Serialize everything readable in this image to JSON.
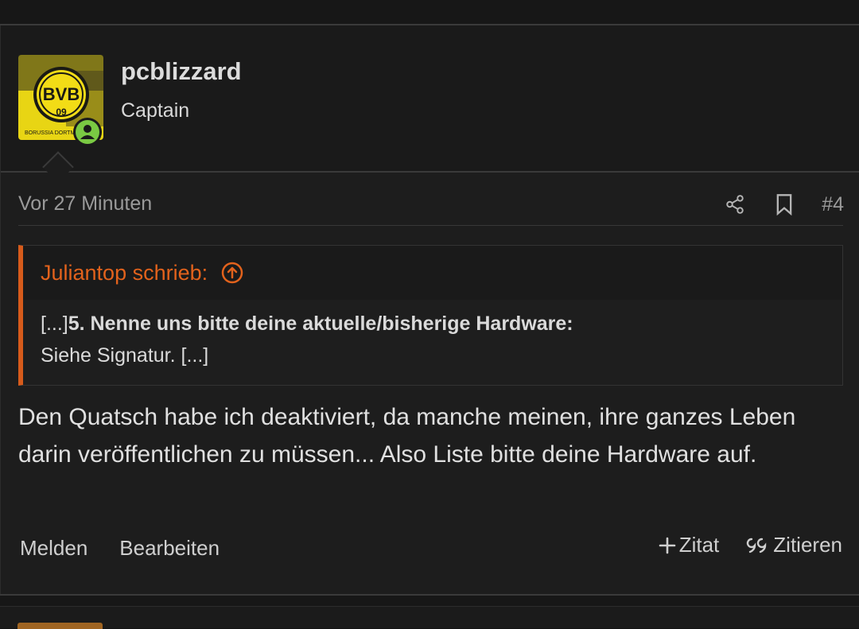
{
  "post": {
    "username": "pcblizzard",
    "rank": "Captain",
    "time": "Vor 27 Minuten",
    "number": "#4",
    "avatar_text": "BVB 09",
    "quote": {
      "title": "Juliantop schrieb:",
      "prefix": "[...]",
      "bold": "5. Nenne uns bitte deine aktuelle/bisherige Hardware:",
      "line2": "Siehe Signatur. [...]"
    },
    "content": "Den Quatsch habe ich deaktiviert, da manche meinen, ihre ganzes Leben darin veröffentlichen zu müssen... Also Liste bitte deine Hardware auf.",
    "footer": {
      "report": "Melden",
      "edit": "Bearbeiten",
      "add_quote": "Zitat",
      "quote": "Zitieren"
    }
  },
  "colors": {
    "accent": "#e2621c",
    "online": "#7ac943",
    "avatar_yellow": "#f2dc16"
  },
  "icons": [
    "share-icon",
    "bookmark-icon",
    "arrow-up-circle-icon",
    "plus-icon",
    "quote-icon",
    "online-status-icon"
  ]
}
